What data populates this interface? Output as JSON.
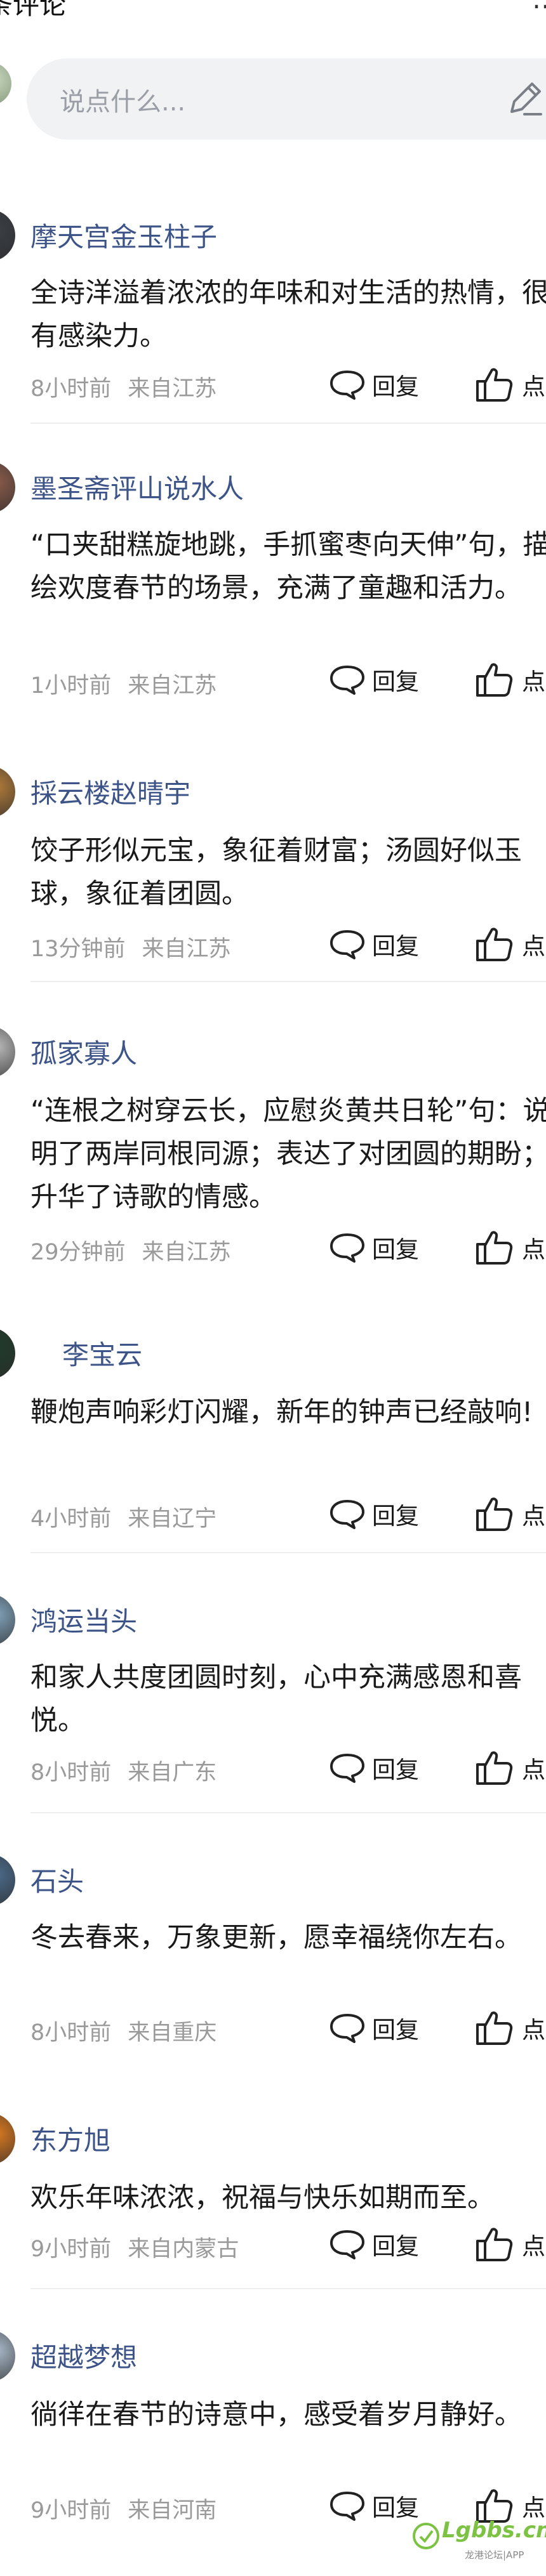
{
  "header": {
    "title": "条评论",
    "more_icon": "ellipsis-icon"
  },
  "compose": {
    "placeholder": "说点什么...",
    "icon": "pen-icon"
  },
  "actions": {
    "reply_label": "回复",
    "like_label": "点赞"
  },
  "comments": [
    {
      "user": "摩天宫金玉柱子",
      "text": "全诗洋溢着浓浓的年味和对生活的热情，很有感染力。",
      "time": "8小时前",
      "region": "来自江苏",
      "avatar_color": "#3a3f45"
    },
    {
      "user": "墨圣斋评山说水人",
      "text": "“口夹甜糕旋地跳，手抓蜜枣向天伸”句，描绘欢度春节的场景，充满了童趣和活力。",
      "time": "1小时前",
      "region": "来自江苏",
      "avatar_color": "#8a5a4a"
    },
    {
      "user": "採云楼赵晴宇",
      "text": "饺子形似元宝，象征着财富；汤圆好似玉球，象征着团圆。",
      "time": "13分钟前",
      "region": "来自江苏",
      "avatar_color": "#b07a3a"
    },
    {
      "user": "孤家寡人",
      "text": "“连根之树穿云长，应慰炎黄共日轮”句：说明了两岸同根同源；表达了对团圆的期盼；升华了诗歌的情感。",
      "time": "29分钟前",
      "region": "来自江苏",
      "avatar_color": "#b8b8b8"
    },
    {
      "user": "李宝云",
      "text": "鞭炮声响彩灯闪耀，新年的钟声已经敲响!",
      "time": "4小时前",
      "region": "来自辽宁",
      "avatar_color": "#1f3b2a"
    },
    {
      "user": "鸿运当头",
      "text": "和家人共度团圆时刻，心中充满感恩和喜悦。",
      "time": "8小时前",
      "region": "来自广东",
      "avatar_color": "#7fa0b8"
    },
    {
      "user": "石头",
      "text": "冬去春来，万象更新，愿幸福绕你左右。",
      "time": "8小时前",
      "region": "来自重庆",
      "avatar_color": "#4a6a8a"
    },
    {
      "user": "东方旭",
      "text": "欢乐年味浓浓，祝福与快乐如期而至。",
      "time": "9小时前",
      "region": "来自内蒙古",
      "avatar_color": "#d9781f"
    },
    {
      "user": "超越梦想",
      "text": "徜徉在春节的诗意中，感受着岁月静好。",
      "time": "9小时前",
      "region": "来自河南",
      "avatar_color": "#a8b8c8"
    }
  ],
  "watermark": {
    "name": "Lgbbs.cn",
    "sub": "龙港论坛|APP"
  }
}
